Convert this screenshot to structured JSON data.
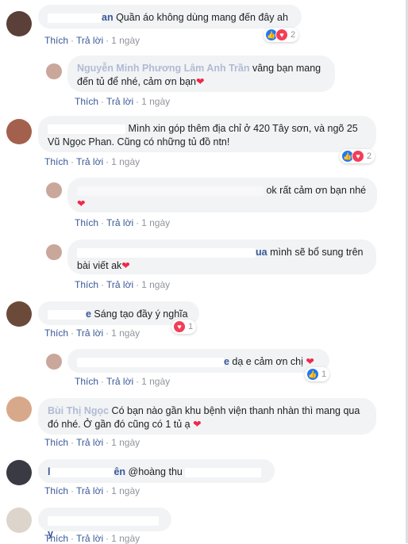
{
  "comments": [
    {
      "id": "c1",
      "name_visible": "an",
      "text": " Quần áo không dùng mang đến đây ah",
      "heart": false,
      "like": "Thích",
      "reply": "Trả lời",
      "time": "1 ngày",
      "reaction_count": "2"
    },
    {
      "id": "r1",
      "name_visible": "Nguyễn Minh Phương Lâm Anh Trần",
      "text": " vâng bạn mang đến tủ để nhé, cảm ơn bạn",
      "heart": true,
      "like": "Thích",
      "reply": "Trả lời",
      "time": "1 ngày"
    },
    {
      "id": "c2",
      "text": "Mình xin góp thêm địa chỉ ở 420 Tây sơn, và ngõ 25 Vũ Ngọc Phan. Cũng có những tủ đồ ntn!",
      "like": "Thích",
      "reply": "Trả lời",
      "time": "1 ngày",
      "reaction_count": "2"
    },
    {
      "id": "r2",
      "text": "ok rất cảm ơn bạn nhé",
      "heart": true,
      "like": "Thích",
      "reply": "Trả lời",
      "time": "1 ngày"
    },
    {
      "id": "r3",
      "name_visible": "ua",
      "text": " mình sẽ bổ sung trên bài viết ak",
      "heart": true,
      "like": "Thích",
      "reply": "Trả lời",
      "time": "1 ngày"
    },
    {
      "id": "c3",
      "name_visible": "e",
      "text": " Sáng tạo đầy ý nghĩa",
      "like": "Thích",
      "reply": "Trả lời",
      "time": "1 ngày",
      "reaction_count": "1"
    },
    {
      "id": "r4",
      "name_visible": "e",
      "text": " dạ e cảm ơn chị",
      "heart": true,
      "like": "Thích",
      "reply": "Trả lời",
      "time": "1 ngày",
      "reaction_count": "1"
    },
    {
      "id": "c4",
      "name_visible": "Bùi Thị Ngọc",
      "text": " Có bạn nào gần khu bệnh viện thanh nhàn thì mang qua đó nhé. Ở gần đó cũng có 1 tủ ạ",
      "heart": true,
      "like": "Thích",
      "reply": "Trả lời",
      "time": "1 ngày"
    },
    {
      "id": "c5",
      "name_visible_start": "l",
      "name_visible_end": "ên",
      "text": " @hoàng thu",
      "like": "Thích",
      "reply": "Trả lời",
      "time": "1 ngày"
    },
    {
      "id": "c6",
      "name_visible": "y",
      "like": "Thích",
      "reply": "Trả lời",
      "time": "1 ngày"
    }
  ],
  "icons": {
    "like": "thumbs-up-icon",
    "love": "heart-icon"
  },
  "colors": {
    "name": "#385898",
    "bubble": "#f2f3f5",
    "like": "#2078f4",
    "love": "#f33e58"
  }
}
